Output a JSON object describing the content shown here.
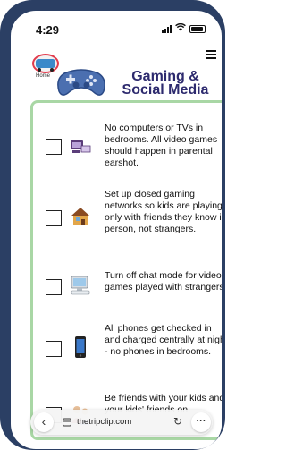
{
  "status_bar": {
    "time": "4:29"
  },
  "header": {
    "home_label": "Home",
    "title_line1": "Gaming &",
    "title_line2": "Social Media"
  },
  "checklist": [
    {
      "icon": "computer-tv-icon",
      "text": "No computers or TVs in bedrooms. All video games should happen in parental earshot."
    },
    {
      "icon": "house-icon",
      "text": "Set up closed gaming networks so kids are playing only with friends they know in person, not strangers."
    },
    {
      "icon": "desktop-computer-icon",
      "text": "Turn off chat mode for video games played with strangers."
    },
    {
      "icon": "smartphone-icon",
      "text": "All phones get checked in and charged centrally at night - no phones in bedrooms."
    },
    {
      "icon": "friends-icon",
      "text": "Be friends with your kids and your kids' friends on"
    }
  ],
  "browser": {
    "url": "thetripclip.com"
  },
  "colors": {
    "title": "#2d2a6e",
    "border": "#a9d7a5",
    "frame": "#2b3f64"
  }
}
